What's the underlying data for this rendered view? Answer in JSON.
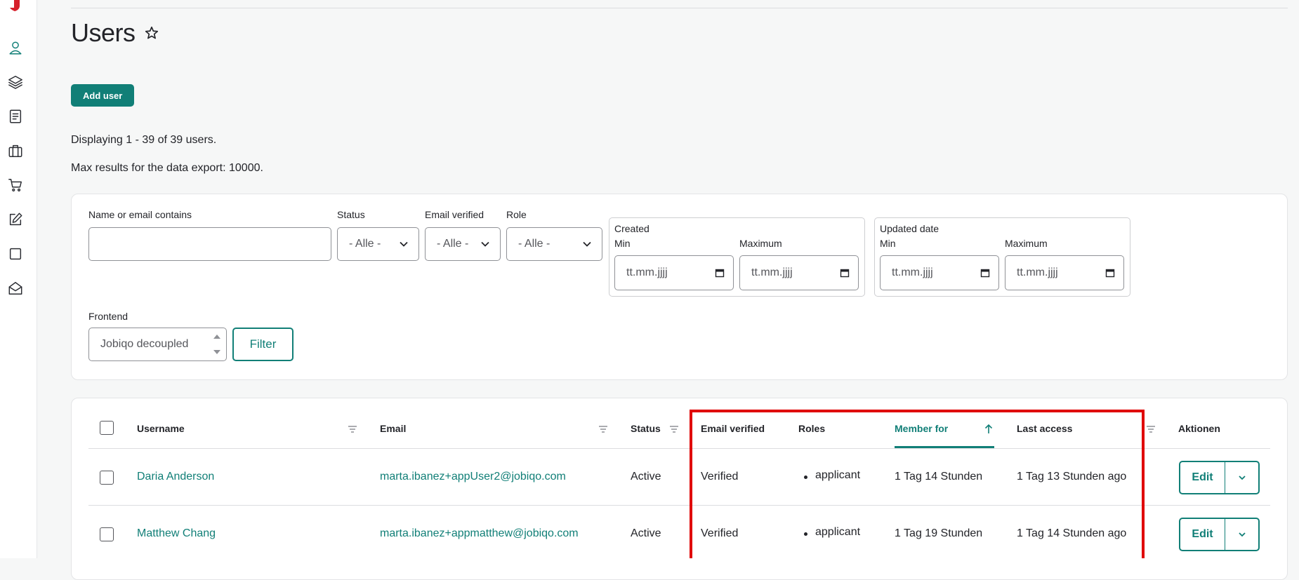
{
  "sidebar": {
    "items": [
      {
        "icon": "user-icon",
        "active": true
      },
      {
        "icon": "layers-icon"
      },
      {
        "icon": "document-icon"
      },
      {
        "icon": "briefcase-icon"
      },
      {
        "icon": "cart-icon"
      },
      {
        "icon": "edit-icon"
      },
      {
        "icon": "square-icon"
      },
      {
        "icon": "mail-open-icon"
      }
    ]
  },
  "page": {
    "title": "Users",
    "add_button": "Add user",
    "display_info": "Displaying 1 - 39 of 39 users.",
    "export_info": "Max results for the data export: 10000."
  },
  "filters": {
    "name_label": "Name or email contains",
    "name_value": "",
    "status_label": "Status",
    "status_value": "- Alle -",
    "email_verified_label": "Email verified",
    "email_verified_value": "- Alle -",
    "role_label": "Role",
    "role_value": "- Alle -",
    "created_legend": "Created",
    "created_min_label": "Min",
    "created_min_value": "tt.mm.jjjj",
    "created_max_label": "Maximum",
    "created_max_value": "tt.mm.jjjj",
    "updated_legend": "Updated date",
    "updated_min_label": "Min",
    "updated_min_value": "tt.mm.jjjj",
    "updated_max_label": "Maximum",
    "updated_max_value": "tt.mm.jjjj",
    "frontend_label": "Frontend",
    "frontend_value": "Jobiqo decoupled",
    "filter_button": "Filter"
  },
  "table": {
    "headers": {
      "username": "Username",
      "email": "Email",
      "status": "Status",
      "email_verified": "Email verified",
      "roles": "Roles",
      "member_for": "Member for",
      "last_access": "Last access",
      "actions": "Aktionen"
    },
    "rows": [
      {
        "username": "Daria Anderson",
        "email": "marta.ibanez+appUser2@jobiqo.com",
        "status": "Active",
        "email_verified": "Verified",
        "role": "applicant",
        "member_for": "1 Tag 14 Stunden",
        "last_access": "1 Tag 13 Stunden ago",
        "edit": "Edit"
      },
      {
        "username": "Matthew Chang",
        "email": "marta.ibanez+appmatthew@jobiqo.com",
        "status": "Active",
        "email_verified": "Verified",
        "role": "applicant",
        "member_for": "1 Tag 19 Stunden",
        "last_access": "1 Tag 14 Stunden ago",
        "edit": "Edit"
      }
    ]
  },
  "colors": {
    "accent": "#117f77",
    "highlight": "#e00000"
  }
}
